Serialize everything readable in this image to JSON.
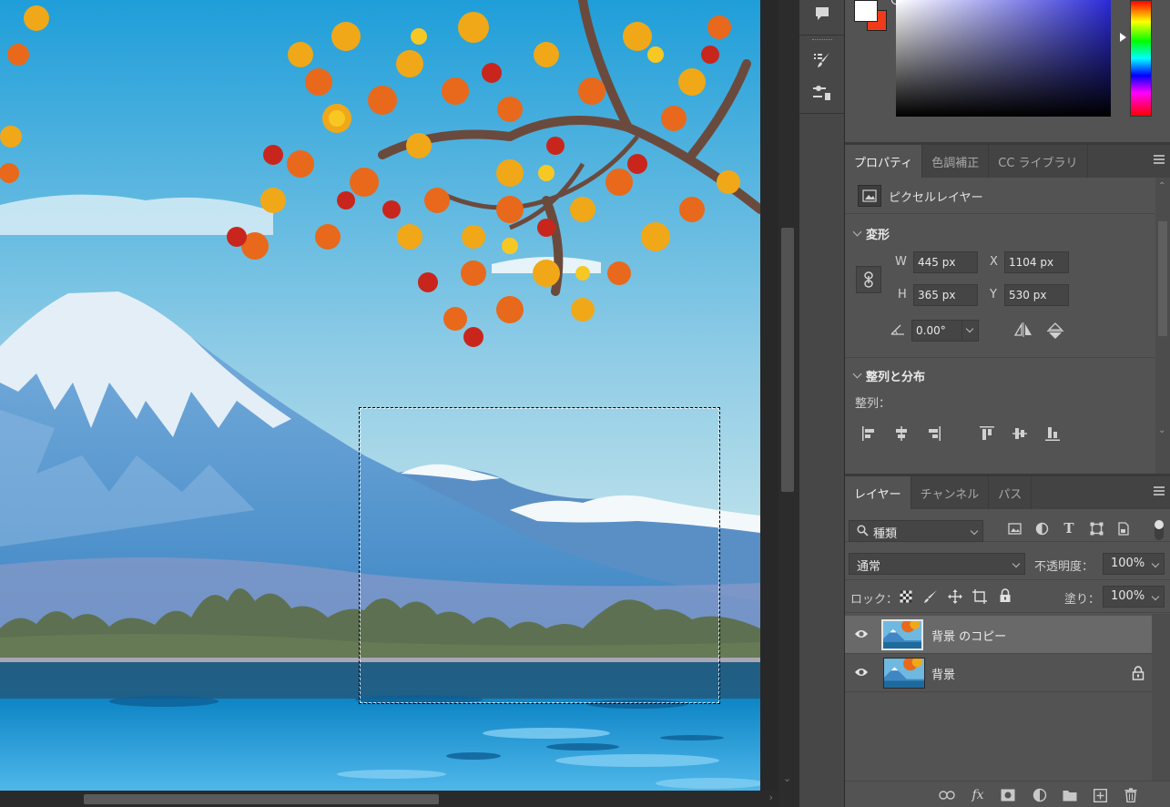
{
  "canvas": {
    "artwork_description": "Mount Fuji with autumn maple leaves over lake",
    "selection_active": true
  },
  "color_panel": {
    "foreground_color": "#ffffff",
    "background_color": "#ef3b1b"
  },
  "properties_panel": {
    "tabs": [
      {
        "label": "プロパティ",
        "active": true
      },
      {
        "label": "色調補正",
        "active": false
      },
      {
        "label": "CC ライブラリ",
        "active": false
      }
    ],
    "layer_type_label": "ピクセルレイヤー",
    "transform": {
      "heading": "変形",
      "w_label": "W",
      "w_value": "445 px",
      "h_label": "H",
      "h_value": "365 px",
      "x_label": "X",
      "x_value": "1104 px",
      "y_label": "Y",
      "y_value": "530 px",
      "angle_value": "0.00°"
    },
    "align_distribute": {
      "heading": "整列と分布",
      "align_label": "整列："
    }
  },
  "layers_panel": {
    "tabs": [
      {
        "label": "レイヤー",
        "active": true
      },
      {
        "label": "チャンネル",
        "active": false
      },
      {
        "label": "パス",
        "active": false
      }
    ],
    "filter_kind": "種類",
    "blend_mode": "通常",
    "opacity_label": "不透明度：",
    "opacity_value": "100%",
    "lock_label": "ロック：",
    "fill_label": "塗り：",
    "fill_value": "100%",
    "layers": [
      {
        "name": "背景 のコピー",
        "visible": true,
        "selected": true,
        "locked": false
      },
      {
        "name": "背景",
        "visible": true,
        "selected": false,
        "locked": true
      }
    ],
    "footer_icons": [
      "link-icon",
      "fx-icon",
      "mask-icon",
      "adjustment-icon",
      "folder-icon",
      "new-layer-icon",
      "trash-icon"
    ],
    "fx_label": "fx"
  },
  "dock_icons": [
    "comment-icon",
    "brush-settings-icon",
    "adjustment-tools-icon"
  ]
}
